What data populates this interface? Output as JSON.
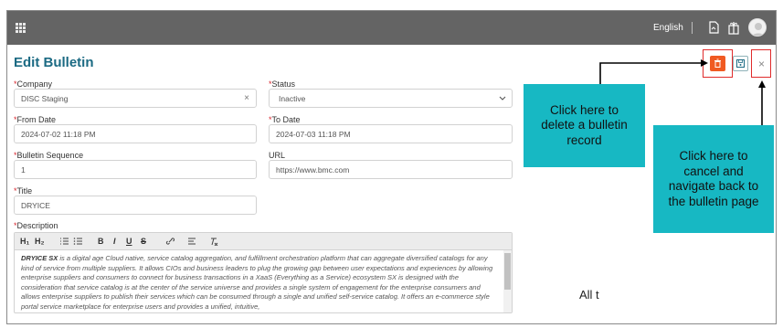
{
  "header": {
    "language": "English",
    "icons": [
      "grid-menu-icon",
      "document-icon",
      "gift-icon",
      "avatar-icon"
    ]
  },
  "page": {
    "title": "Edit Bulletin"
  },
  "actions": {
    "delete_icon": "trash-icon",
    "save_icon": "save-icon",
    "close_label": "×"
  },
  "form": {
    "company": {
      "label": "Company",
      "required": "*",
      "value": "DISC Staging",
      "clear": "×"
    },
    "status": {
      "label": "Status",
      "required": "*",
      "value": "Inactive"
    },
    "from_date": {
      "label": "From Date",
      "required": "*",
      "value": "2024-07-02 11:18 PM"
    },
    "to_date": {
      "label": "To Date",
      "required": "*",
      "value": "2024-07-03 11:18 PM"
    },
    "sequence": {
      "label": "Bulletin Sequence",
      "required": "*",
      "value": "1"
    },
    "url": {
      "label": "URL",
      "value": "https://www.bmc.com"
    },
    "title": {
      "label": "Title",
      "required": "*",
      "value": "DRYICE"
    },
    "description": {
      "label": "Description",
      "required": "*",
      "toolbar": [
        "H₁",
        "H₂",
        "ordered-list-icon",
        "bullet-list-icon",
        "B",
        "I",
        "U",
        "S",
        "link-icon",
        "align-icon",
        "clear-format-icon"
      ],
      "lead": "DRYICE SX",
      "text": " is a digital age Cloud native, service catalog aggregation, and fulfillment orchestration platform that can aggregate diversified catalogs for any kind of service from multiple suppliers. It allows CIOs and business leaders to plug the growing gap between user expectations and experiences by allowing enterprise suppliers and consumers to connect for business transactions in a XaaS (Everything as a Service) ecosystem SX is designed with the consideration that service catalog is at the center of the service universe and provides a single system of engagement for the enterprise consumers and allows enterprise suppliers to publish their services which can be consumed through a single and unified self-service catalog. It offers an e-commerce style portal service marketplace for enterprise users and provides a unified, intuitive,"
    }
  },
  "callouts": {
    "delete": "Click here to delete a bulletin record",
    "cancel": "Click here to cancel and navigate back to the bulletin page",
    "trailing_text": "All t"
  },
  "colors": {
    "topbar": "#646464",
    "title": "#1b6a83",
    "delete_button": "#f05a22",
    "callout": "#17b8c3",
    "highlight": "#e02b2b"
  }
}
